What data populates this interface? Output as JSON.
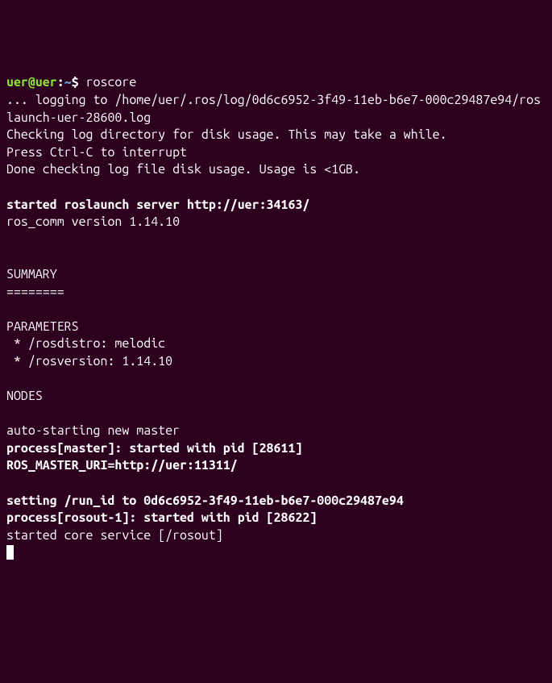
{
  "prompt": {
    "user_host": "uer@uer",
    "sep1": ":",
    "path": "~",
    "sep2": "$ "
  },
  "command": "roscore",
  "lines": {
    "l1": "... logging to /home/uer/.ros/log/0d6c6952-3f49-11eb-b6e7-000c29487e94/roslaunch-uer-28600.log",
    "l2": "Checking log directory for disk usage. This may take a while.",
    "l3": "Press Ctrl-C to interrupt",
    "l4": "Done checking log file disk usage. Usage is <1GB.",
    "l5": "",
    "l6": "started roslaunch server http://uer:34163/",
    "l7": "ros_comm version 1.14.10",
    "l8": "",
    "l9": "",
    "l10": "SUMMARY",
    "l11": "========",
    "l12": "",
    "l13": "PARAMETERS",
    "l14": " * /rosdistro: melodic",
    "l15": " * /rosversion: 1.14.10",
    "l16": "",
    "l17": "NODES",
    "l18": "",
    "l19": "auto-starting new master",
    "l20": "process[master]: started with pid [28611]",
    "l21": "ROS_MASTER_URI=http://uer:11311/",
    "l22": "",
    "l23": "setting /run_id to 0d6c6952-3f49-11eb-b6e7-000c29487e94",
    "l24": "process[rosout-1]: started with pid [28622]",
    "l25": "started core service [/rosout]"
  }
}
